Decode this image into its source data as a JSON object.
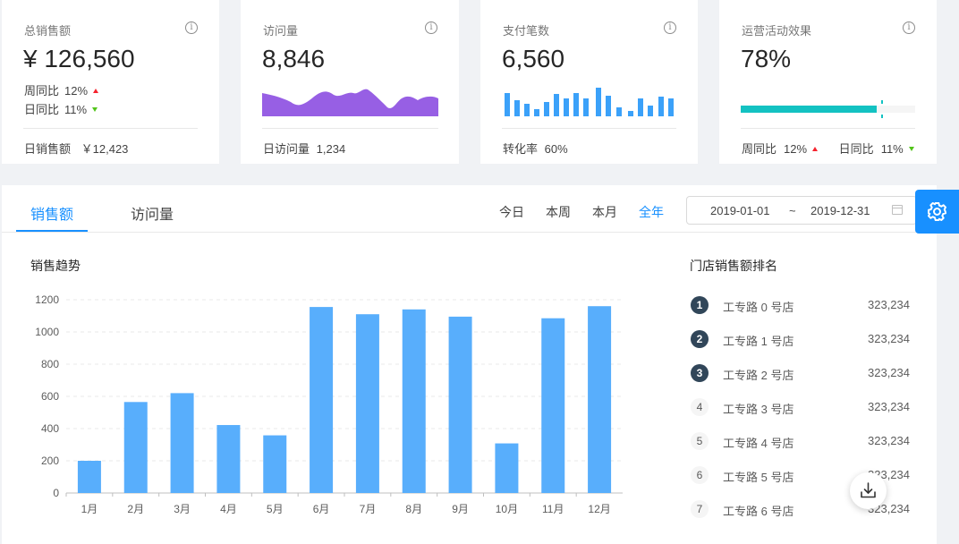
{
  "cards": [
    {
      "title": "总销售额",
      "value": "¥ 126,560",
      "wow_label": "周同比",
      "wow_value": "12%",
      "dod_label": "日同比",
      "dod_value": "11%",
      "footer_label": "日销售额",
      "footer_value": "￥12,423"
    },
    {
      "title": "访问量",
      "value": "8,846",
      "footer_label": "日访问量",
      "footer_value": "1,234",
      "area_color": "#975fe4"
    },
    {
      "title": "支付笔数",
      "value": "6,560",
      "footer_label": "转化率",
      "footer_value": "60%",
      "bar_color": "#3ba1f9"
    },
    {
      "title": "运营活动效果",
      "value": "78%",
      "progress": 0.78,
      "progress_color": "#13c2c2",
      "target_color": "#13c2c2",
      "wow_label": "周同比",
      "wow_value": "12%",
      "dod_label": "日同比",
      "dod_value": "11%"
    }
  ],
  "info_icon_glyph": "i",
  "tabs": [
    "销售额",
    "访问量"
  ],
  "ranges": [
    "今日",
    "本周",
    "本月",
    "全年"
  ],
  "active_range": "全年",
  "date_picker": {
    "start": "2019-01-01",
    "separator": "~",
    "end": "2019-12-31"
  },
  "sales_title": "销售趋势",
  "ranking_title": "门店销售额排名",
  "ranking": [
    {
      "rank": "1",
      "name": "工专路 0 号店",
      "value": "323,234"
    },
    {
      "rank": "2",
      "name": "工专路 1 号店",
      "value": "323,234"
    },
    {
      "rank": "3",
      "name": "工专路 2 号店",
      "value": "323,234"
    },
    {
      "rank": "4",
      "name": "工专路 3 号店",
      "value": "323,234"
    },
    {
      "rank": "5",
      "name": "工专路 4 号店",
      "value": "323,234"
    },
    {
      "rank": "6",
      "name": "工专路 5 号店",
      "value": "323,234"
    },
    {
      "rank": "7",
      "name": "工专路 6 号店",
      "value": "323,234"
    }
  ],
  "accent_color": "#1890ff",
  "chart_data": {
    "type": "bar",
    "categories": [
      "1月",
      "2月",
      "3月",
      "4月",
      "5月",
      "6月",
      "7月",
      "8月",
      "9月",
      "10月",
      "11月",
      "12月"
    ],
    "values": [
      200,
      565,
      620,
      422,
      358,
      1155,
      1110,
      1140,
      1095,
      308,
      1085,
      1160
    ],
    "yticks": [
      0,
      200,
      400,
      600,
      800,
      1000,
      1200
    ],
    "ylim": [
      0,
      1200
    ],
    "color": "#58aefc",
    "grid": true
  }
}
